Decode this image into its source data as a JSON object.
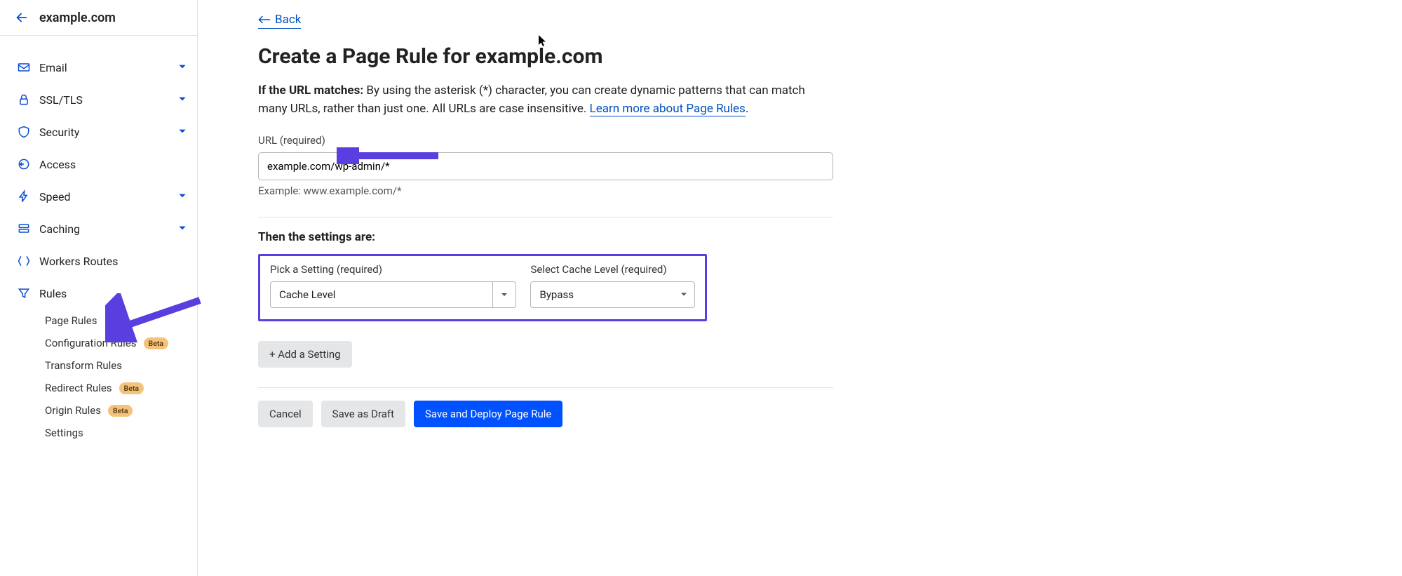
{
  "header": {
    "site_name": "example.com"
  },
  "sidebar": {
    "items": [
      {
        "label": "Email",
        "caret": true
      },
      {
        "label": "SSL/TLS",
        "caret": true
      },
      {
        "label": "Security",
        "caret": true
      },
      {
        "label": "Access",
        "caret": false
      },
      {
        "label": "Speed",
        "caret": true
      },
      {
        "label": "Caching",
        "caret": true
      },
      {
        "label": "Workers Routes",
        "caret": false
      },
      {
        "label": "Rules",
        "caret": false
      }
    ],
    "rules_sub": [
      {
        "label": "Page Rules",
        "badge": ""
      },
      {
        "label": "Configuration Rules",
        "badge": "Beta"
      },
      {
        "label": "Transform Rules",
        "badge": ""
      },
      {
        "label": "Redirect Rules",
        "badge": "Beta"
      },
      {
        "label": "Origin Rules",
        "badge": "Beta"
      },
      {
        "label": "Settings",
        "badge": ""
      }
    ]
  },
  "main": {
    "back_label": "Back",
    "title": "Create a Page Rule for example.com",
    "help_bold": "If the URL matches:",
    "help_text": " By using the asterisk (*) character, you can create dynamic patterns that can match many URLs, rather than just one. All URLs are case insensitive. ",
    "help_link": "Learn more about Page Rules",
    "help_tail": ".",
    "url_label": "URL (required)",
    "url_value": "example.com/wp-admin/*",
    "url_example": "Example: www.example.com/*",
    "then_label": "Then the settings are:",
    "setting_pick_label": "Pick a Setting (required)",
    "setting_pick_value": "Cache Level",
    "setting_level_label": "Select Cache Level (required)",
    "setting_level_value": "Bypass",
    "add_setting": "+ Add a Setting",
    "cancel": "Cancel",
    "save_draft": "Save as Draft",
    "save_deploy": "Save and Deploy Page Rule"
  },
  "annotation_color": "#5a3ee0"
}
